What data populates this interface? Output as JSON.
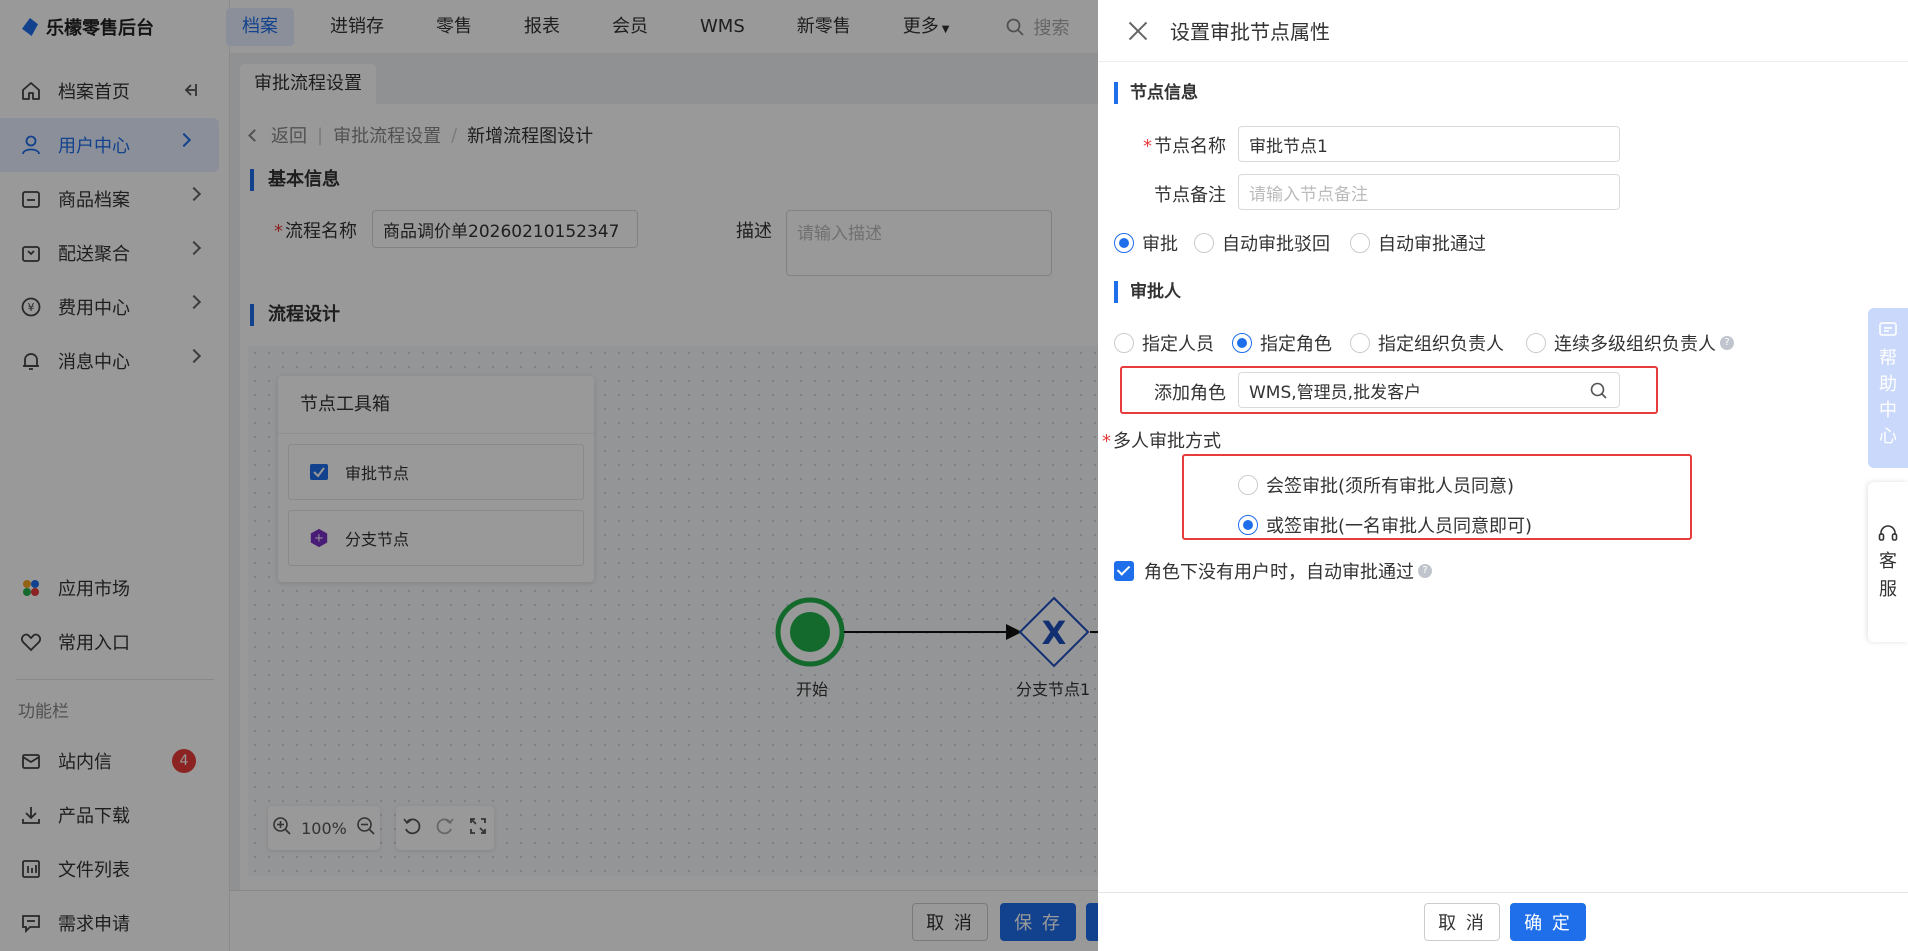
{
  "app": {
    "name": "乐檬零售后台"
  },
  "topnav": {
    "items": [
      "档案",
      "进销存",
      "零售",
      "报表",
      "会员",
      "WMS",
      "新零售",
      "更多"
    ],
    "search_placeholder": "搜索"
  },
  "sidebar": {
    "items": [
      {
        "label": "档案首页",
        "icon": "home-icon"
      },
      {
        "label": "用户中心",
        "icon": "user-icon"
      },
      {
        "label": "商品档案",
        "icon": "goods-icon"
      },
      {
        "label": "配送聚合",
        "icon": "delivery-icon"
      },
      {
        "label": "费用中心",
        "icon": "yen-icon"
      },
      {
        "label": "消息中心",
        "icon": "bell-icon"
      }
    ],
    "bottom_items": [
      {
        "label": "应用市场",
        "icon": "app-market-icon"
      },
      {
        "label": "常用入口",
        "icon": "heart-icon"
      }
    ],
    "section_title": "功能栏",
    "func_items": [
      {
        "label": "站内信",
        "badge": "4",
        "icon": "mail-icon"
      },
      {
        "label": "产品下载",
        "icon": "download-icon"
      },
      {
        "label": "文件列表",
        "icon": "file-list-icon"
      },
      {
        "label": "需求申请",
        "icon": "request-icon"
      }
    ]
  },
  "tab": {
    "label": "审批流程设置"
  },
  "breadcrumb": {
    "back": "返回",
    "parent": "审批流程设置",
    "current": "新增流程图设计"
  },
  "basic_info": {
    "title": "基本信息",
    "name_label": "流程名称",
    "name_value": "商品调价单20260210152347",
    "desc_label": "描述",
    "desc_placeholder": "请输入描述"
  },
  "flow_design": {
    "title": "流程设计",
    "toolbox_title": "节点工具箱",
    "tools": [
      "审批节点",
      "分支节点"
    ],
    "zoom": "100%",
    "nodes": {
      "start": "开始",
      "branch": "分支节点1"
    }
  },
  "main_footer": {
    "cancel": "取 消",
    "save": "保 存"
  },
  "drawer": {
    "title": "设置审批节点属性",
    "node_info_title": "节点信息",
    "node_name_label": "节点名称",
    "node_name_value": "审批节点1",
    "node_remark_label": "节点备注",
    "node_remark_placeholder": "请输入节点备注",
    "approval_types": [
      "审批",
      "自动审批驳回",
      "自动审批通过"
    ],
    "approver_title": "审批人",
    "approver_types": [
      "指定人员",
      "指定角色",
      "指定组织负责人",
      "连续多级组织负责人"
    ],
    "add_role_label": "添加角色",
    "add_role_value": "WMS,管理员,批发客户",
    "multi_mode_label": "多人审批方式",
    "multi_modes": [
      "会签审批(须所有审批人员同意)",
      "或签审批(一名审批人员同意即可)"
    ],
    "auto_pass_label": "角色下没有用户时，自动审批通过",
    "cancel": "取 消",
    "confirm": "确 定"
  },
  "side_tabs": {
    "help": [
      "帮",
      "助",
      "中",
      "心"
    ],
    "cs": [
      "客",
      "服"
    ]
  },
  "colors": {
    "primary": "#1f6feb",
    "danger": "#e83b3b",
    "start_node": "#22b14c",
    "branch_node": "#1f4fbf"
  }
}
